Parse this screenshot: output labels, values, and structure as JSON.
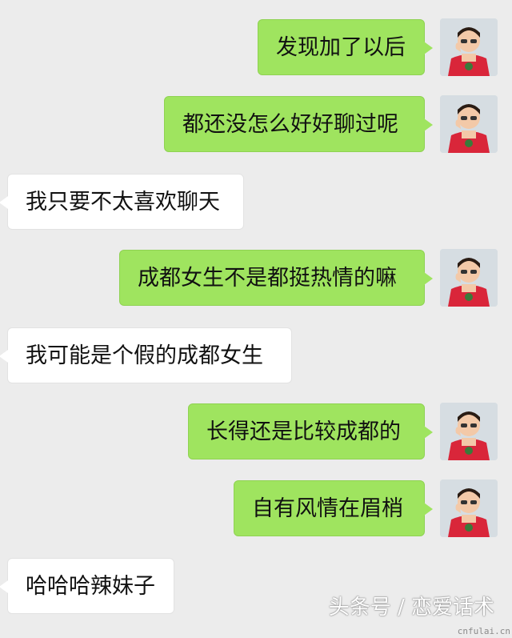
{
  "messages": [
    {
      "side": "mine",
      "text": "发现加了以后"
    },
    {
      "side": "mine",
      "text": "都还没怎么好好聊过呢"
    },
    {
      "side": "theirs",
      "text": "我只要不太喜欢聊天"
    },
    {
      "side": "mine",
      "text": "成都女生不是都挺热情的嘛"
    },
    {
      "side": "theirs",
      "text": "我可能是个假的成都女生"
    },
    {
      "side": "mine",
      "text": "长得还是比较成都的"
    },
    {
      "side": "mine",
      "text": "自有风情在眉梢"
    },
    {
      "side": "theirs",
      "text": "哈哈哈辣妹子"
    }
  ],
  "colors": {
    "background": "#ececec",
    "mine_bubble": "#9fe45f",
    "theirs_bubble": "#ffffff",
    "avatar_shirt": "#d9263a"
  },
  "watermark": "头条号 / 恋爱话术",
  "site_mark": "cnfulai.cn"
}
